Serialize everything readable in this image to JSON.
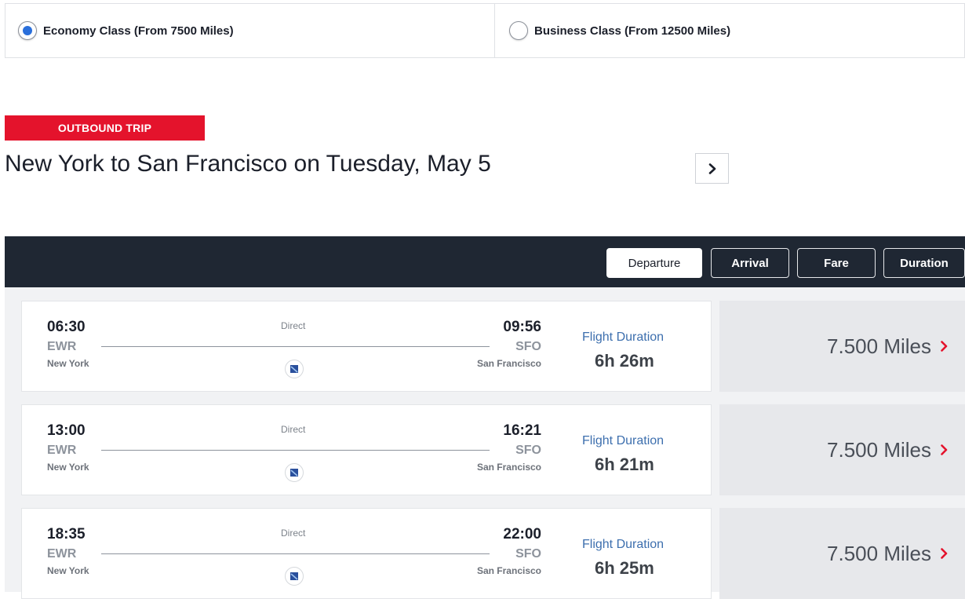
{
  "cabin_classes": [
    {
      "label": "Economy Class (From 7500 Miles)",
      "selected": true
    },
    {
      "label": "Business Class (From 12500 Miles)",
      "selected": false
    }
  ],
  "trip": {
    "badge": "OUTBOUND TRIP",
    "title": "New York to San Francisco on Tuesday, May 5"
  },
  "sort_options": [
    {
      "label": "Departure",
      "active": true
    },
    {
      "label": "Arrival",
      "active": false
    },
    {
      "label": "Fare",
      "active": false
    },
    {
      "label": "Duration",
      "active": false
    }
  ],
  "flights": [
    {
      "departure_time": "06:30",
      "departure_code": "EWR",
      "departure_city": "New York",
      "arrival_time": "09:56",
      "arrival_code": "SFO",
      "arrival_city": "San Francisco",
      "stops": "Direct",
      "duration_label": "Flight Duration",
      "duration": "6h 26m",
      "price": "7.500 Miles"
    },
    {
      "departure_time": "13:00",
      "departure_code": "EWR",
      "departure_city": "New York",
      "arrival_time": "16:21",
      "arrival_code": "SFO",
      "arrival_city": "San Francisco",
      "stops": "Direct",
      "duration_label": "Flight Duration",
      "duration": "6h 21m",
      "price": "7.500 Miles"
    },
    {
      "departure_time": "18:35",
      "departure_code": "EWR",
      "departure_city": "New York",
      "arrival_time": "22:00",
      "arrival_code": "SFO",
      "arrival_city": "San Francisco",
      "stops": "Direct",
      "duration_label": "Flight Duration",
      "duration": "6h 25m",
      "price": "7.500 Miles"
    }
  ],
  "colors": {
    "accent_red": "#e4132c",
    "radio_blue": "#2a6fdb",
    "sort_bar_bg": "#1f2733",
    "duration_label": "#3d6fae"
  },
  "icons": {
    "next": "chevron-right-icon",
    "price_arrow": "chevron-right-icon",
    "airline": "airline-logo-icon"
  }
}
